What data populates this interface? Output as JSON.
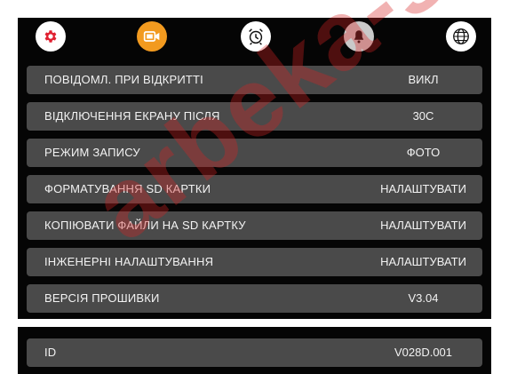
{
  "tabs": [
    {
      "name": "settings",
      "icon": "gear-icon",
      "color": "#e02030",
      "active": true
    },
    {
      "name": "video",
      "icon": "video-camera-icon",
      "color": "#f29a1f"
    },
    {
      "name": "alarm",
      "icon": "alarm-clock-icon"
    },
    {
      "name": "bell",
      "icon": "bell-icon"
    },
    {
      "name": "language",
      "icon": "globe-icon"
    }
  ],
  "settings": [
    {
      "label": "ПОВІДОМЛ. ПРИ ВІДКРИТТІ",
      "value": "ВИКЛ"
    },
    {
      "label": "ВІДКЛЮЧЕННЯ ЕКРАНУ ПІСЛЯ",
      "value": "30С"
    },
    {
      "label": "РЕЖИМ ЗАПИСУ",
      "value": "ФОТО"
    },
    {
      "label": "ФОРМАТУВАННЯ SD КАРТКИ",
      "value": "НАЛАШТУВАТИ"
    },
    {
      "label": "КОПІЮВАТИ ФАЙЛИ НА SD КАРТКУ",
      "value": "НАЛАШТУВАТИ"
    },
    {
      "label": "ІНЖЕНЕРНІ НАЛАШТУВАННЯ",
      "value": "НАЛАШТУВАТИ"
    },
    {
      "label": "ВЕРСІЯ ПРОШИВКИ",
      "value": "V3.04"
    }
  ],
  "device_id": {
    "label": "ID",
    "value": "V028D.001"
  },
  "watermark_text": "arbeka-she",
  "colors": {
    "background": "#050505",
    "row": "#4a4a4a",
    "accent_red": "#e02030",
    "accent_orange": "#f29a1f"
  }
}
